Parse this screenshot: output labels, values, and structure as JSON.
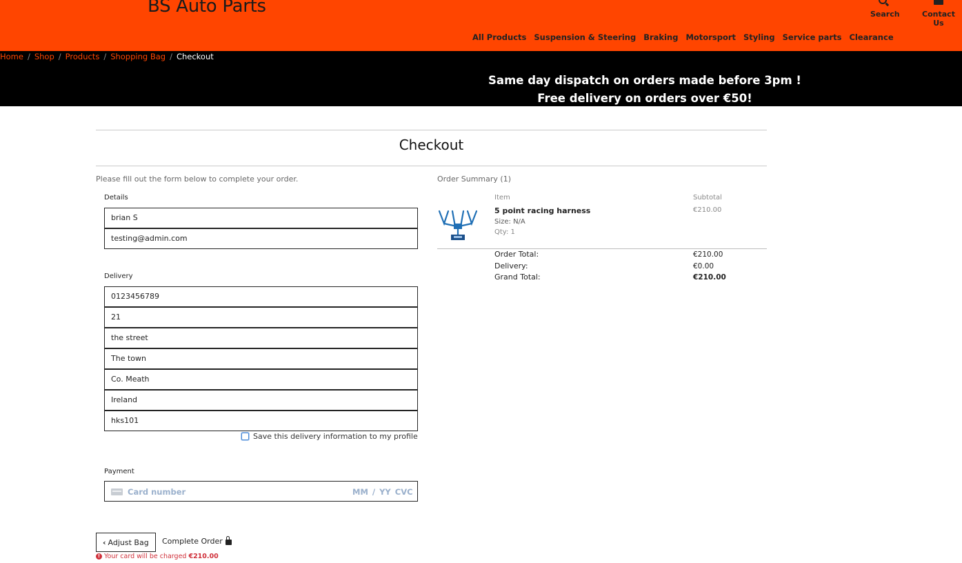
{
  "header": {
    "brand": "BS Auto Parts",
    "search_label": "Search",
    "contact_label": "Contact Us",
    "nav": [
      "All Products",
      "Suspension & Steering",
      "Braking",
      "Motorsport",
      "Styling",
      "Service parts",
      "Clearance"
    ]
  },
  "breadcrumb": {
    "items": [
      "Home",
      "Shop",
      "Products",
      "Shopping Bag"
    ],
    "current": "Checkout"
  },
  "banner": {
    "line1": "Same day dispatch on orders made before 3pm !",
    "line2": "Free delivery on orders over €50!"
  },
  "checkout": {
    "title": "Checkout",
    "intro": "Please fill out the form below to complete your order.",
    "details_label": "Details",
    "details": {
      "full_name": "brian S",
      "email": "testing@admin.com"
    },
    "delivery_label": "Delivery",
    "delivery": {
      "phone": "0123456789",
      "street1": "21",
      "street2": "the street",
      "town": "The town",
      "county": "Co. Meath",
      "country": "Ireland",
      "postcode": "hks101"
    },
    "save_info_label": "Save this delivery information to my profile",
    "save_info_checked": false,
    "payment_label": "Payment",
    "card": {
      "number_placeholder": "Card number",
      "expiry_cvc_placeholder": "MM / YY  CVC"
    },
    "adjust_bag_label": "Adjust Bag",
    "complete_order_label": "Complete Order",
    "charge_text": "Your card will be charged",
    "charge_amount": "€210.00"
  },
  "summary": {
    "heading": "Order Summary (1)",
    "col_item": "Item",
    "col_subtotal": "Subtotal",
    "item": {
      "name": "5 point racing harness",
      "size": "Size: N/A",
      "qty": "Qty: 1",
      "subtotal": "€210.00"
    },
    "order_total_label": "Order Total:",
    "order_total": "€210.00",
    "delivery_label": "Delivery:",
    "delivery": "€0.00",
    "grand_total_label": "Grand Total:",
    "grand_total": "€210.00"
  },
  "colors": {
    "brand_orange": "#ff4500",
    "banner_black": "#000000",
    "warning_red": "#d0313b"
  }
}
